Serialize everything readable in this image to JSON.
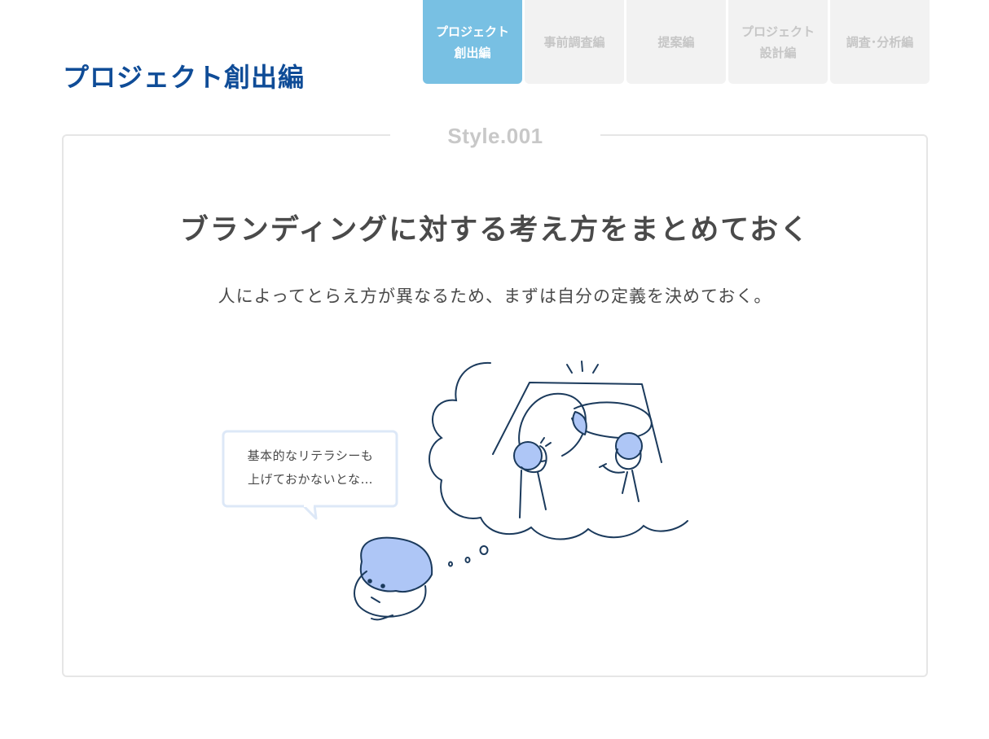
{
  "section_title": "プロジェクト創出編",
  "tabs": [
    {
      "label": "プロジェクト\n創出編",
      "active": true
    },
    {
      "label": "事前調査編",
      "active": false
    },
    {
      "label": "提案編",
      "active": false
    },
    {
      "label": "プロジェクト\n設計編",
      "active": false
    },
    {
      "label": "調査･分析編",
      "active": false
    }
  ],
  "card": {
    "style_label": "Style.001",
    "headline": "ブランディングに対する考え方をまとめておく",
    "subtext": "人によってとらえ方が異なるため、まずは自分の定義を決めておく。",
    "speech_bubble": {
      "line1": "基本的なリテラシーも",
      "line2": "上げておかないとな…"
    }
  },
  "colors": {
    "title_blue": "#0f4c97",
    "tab_active": "#78c0e3",
    "tab_inactive": "#f2f2f2",
    "tab_inactive_text": "#c6c6c6",
    "illustration_fill": "#aec6f6",
    "illustration_line": "#1b3a5c"
  }
}
